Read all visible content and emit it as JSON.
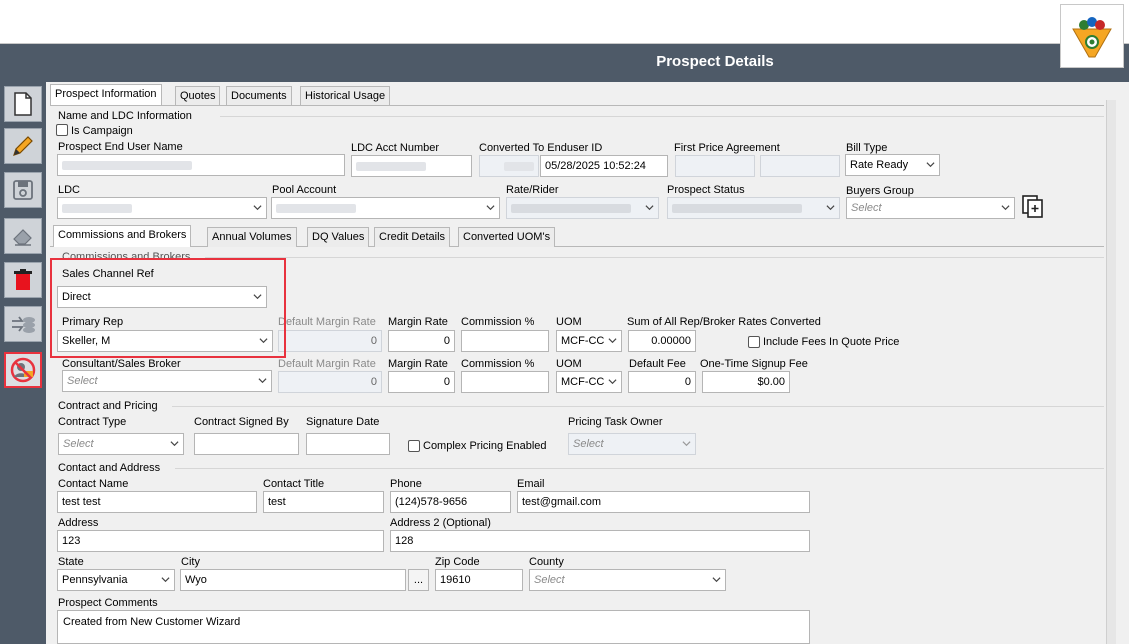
{
  "window": {
    "title": "Prospect Details"
  },
  "tabs": [
    "Prospect Information",
    "Quotes",
    "Documents",
    "Historical Usage"
  ],
  "name_ldc": {
    "section_title": "Name and LDC Information",
    "is_campaign_label": "Is Campaign",
    "prospect_end_user_name_label": "Prospect End User Name",
    "ldc_acct_number_label": "LDC Acct Number",
    "converted_to_enduser_id_label": "Converted To Enduser ID",
    "converted_date": "05/28/2025 10:52:24",
    "first_price_agreement_label": "First Price Agreement",
    "bill_type_label": "Bill Type",
    "bill_type_value": "Rate Ready",
    "ldc_label": "LDC",
    "pool_account_label": "Pool Account",
    "rate_rider_label": "Rate/Rider",
    "prospect_status_label": "Prospect Status",
    "buyers_group_label": "Buyers Group",
    "buyers_group_placeholder": "Select"
  },
  "subtabs": [
    "Commissions and Brokers",
    "Annual Volumes",
    "DQ Values",
    "Credit Details",
    "Converted UOM's"
  ],
  "commissions": {
    "section_title": "Commissions and Brokers",
    "sales_channel_ref_label": "Sales Channel Ref",
    "sales_channel_ref_value": "Direct",
    "primary_rep_label": "Primary Rep",
    "primary_rep_value": "Skeller, M",
    "default_margin_rate_label": "Default Margin Rate",
    "margin_rate_label": "Margin Rate",
    "commission_pct_label": "Commission %",
    "uom_label": "UOM",
    "sum_rates_label": "Sum of All Rep/Broker Rates Converted",
    "rep_default_margin_rate": "0",
    "rep_margin_rate": "0",
    "rep_uom": "MCF-CC",
    "sum_rates_value": "0.00000",
    "include_fees_label": "Include Fees In Quote Price",
    "consultant_label": "Consultant/Sales Broker",
    "consultant_placeholder": "Select",
    "default_fee_label": "Default Fee",
    "one_time_fee_label": "One-Time Signup Fee",
    "broker_default_margin_rate": "0",
    "broker_margin_rate": "0",
    "broker_uom": "MCF-CC",
    "default_fee_value": "0",
    "one_time_fee_value": "$0.00"
  },
  "contract": {
    "section_title": "Contract and Pricing",
    "contract_type_label": "Contract Type",
    "contract_type_placeholder": "Select",
    "contract_signed_by_label": "Contract Signed By",
    "signature_date_label": "Signature Date",
    "complex_pricing_label": "Complex Pricing Enabled",
    "pricing_task_owner_label": "Pricing Task Owner",
    "pricing_task_owner_placeholder": "Select"
  },
  "contact": {
    "section_title": "Contact and Address",
    "contact_name_label": "Contact Name",
    "contact_name_value": "test test",
    "contact_title_label": "Contact Title",
    "contact_title_value": "test",
    "phone_label": "Phone",
    "phone_value": "(124)578-9656",
    "email_label": "Email",
    "email_value": "test@gmail.com",
    "address_label": "Address",
    "address_value": "123",
    "address2_label": "Address 2 (Optional)",
    "address2_value": "128",
    "state_label": "State",
    "state_value": "Pennsylvania",
    "city_label": "City",
    "city_value": "Wyo",
    "city_button": "...",
    "zip_label": "Zip Code",
    "zip_value": "19610",
    "county_label": "County",
    "county_placeholder": "Select",
    "comments_label": "Prospect Comments",
    "comments_value": "Created from New Customer Wizard"
  },
  "colors": {
    "titlebar": "#4e5a68",
    "highlight": "#e8323e"
  }
}
